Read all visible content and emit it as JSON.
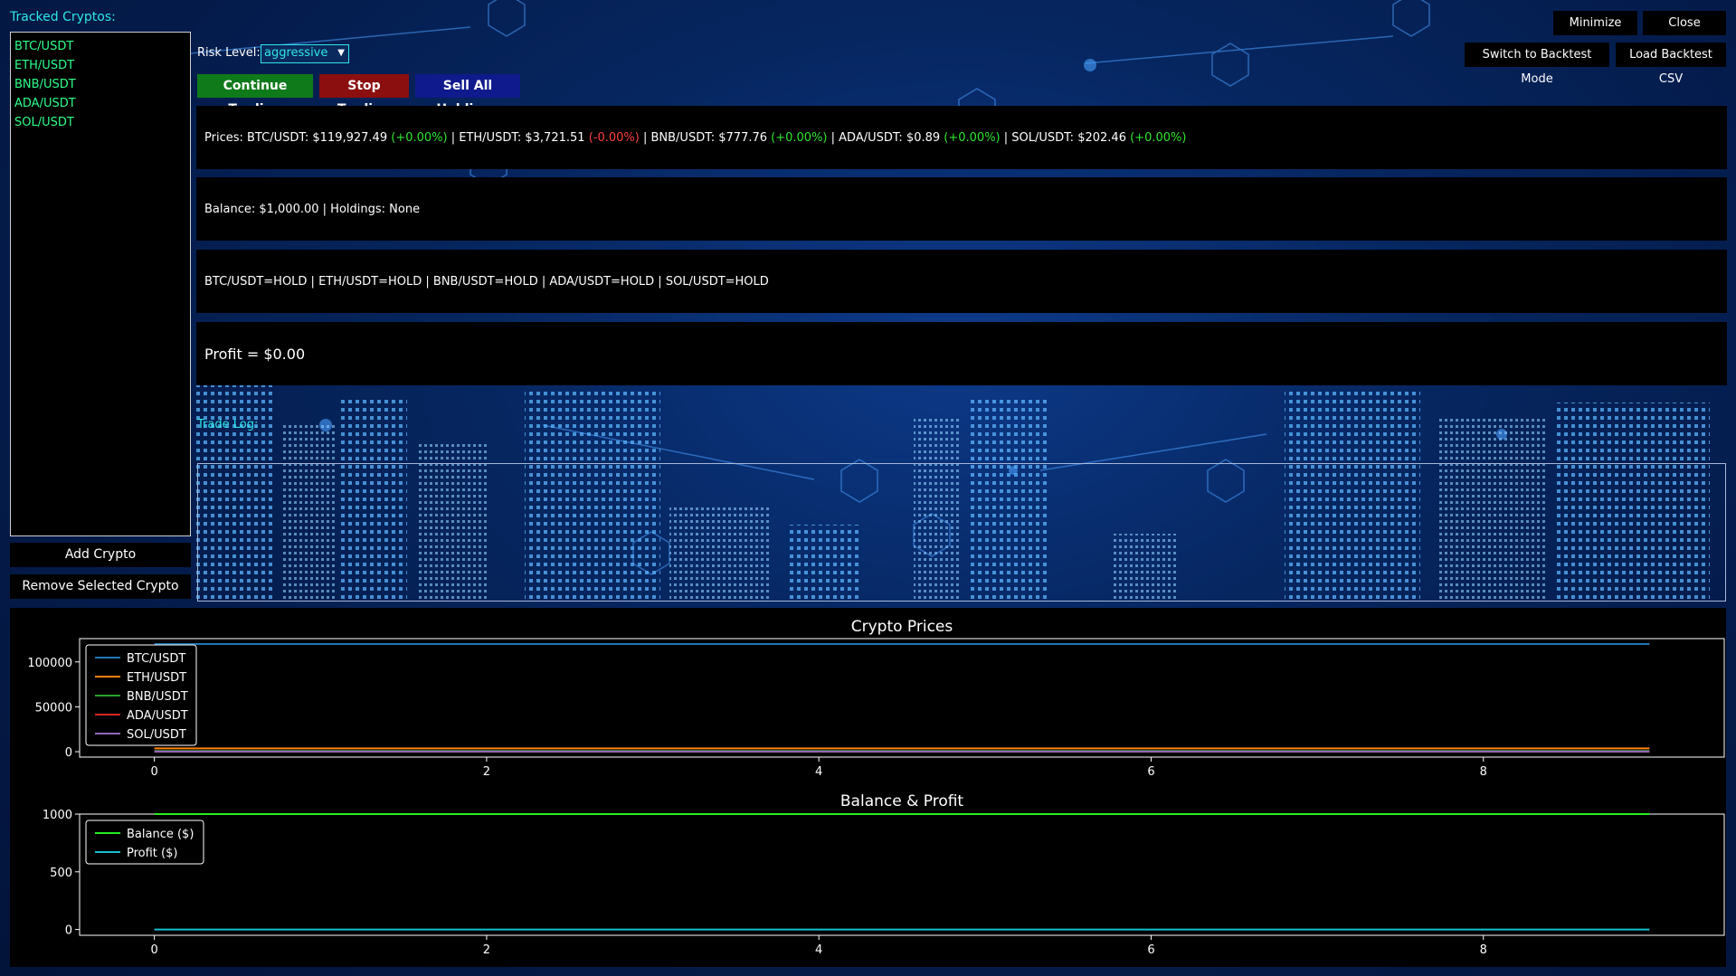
{
  "sidebar": {
    "title": "Tracked Cryptos:",
    "items": [
      "BTC/USDT",
      "ETH/USDT",
      "BNB/USDT",
      "ADA/USDT",
      "SOL/USDT"
    ],
    "add_button": "Add Crypto",
    "remove_button": "Remove Selected Crypto"
  },
  "controls": {
    "risk_label": "Risk Level:",
    "risk_value": "aggressive",
    "continue_button": "Continue Trading",
    "stop_button": "Stop Trading",
    "sell_all_button": "Sell All Holdings"
  },
  "window_buttons": {
    "minimize": "Minimize",
    "close": "Close",
    "switch_backtest": "Switch to Backtest Mode",
    "load_csv": "Load Backtest CSV"
  },
  "prices": {
    "prefix": "Prices:",
    "entries": [
      {
        "pair": "BTC/USDT:",
        "price": "$119,927.49",
        "change": "(+0.00%)",
        "dir": "up"
      },
      {
        "pair": "ETH/USDT:",
        "price": "$3,721.51",
        "change": "(-0.00%)",
        "dir": "down"
      },
      {
        "pair": "BNB/USDT:",
        "price": "$777.76",
        "change": "(+0.00%)",
        "dir": "up"
      },
      {
        "pair": "ADA/USDT:",
        "price": "$0.89",
        "change": "(+0.00%)",
        "dir": "up"
      },
      {
        "pair": "SOL/USDT:",
        "price": "$202.46",
        "change": "(+0.00%)",
        "dir": "up"
      }
    ]
  },
  "balance_text": "Balance: $1,000.00 | Holdings: None",
  "signals_text": "BTC/USDT=HOLD | ETH/USDT=HOLD | BNB/USDT=HOLD | ADA/USDT=HOLD | SOL/USDT=HOLD",
  "profit_text": "Profit = $0.00",
  "trade_log_label": "Trade Log:",
  "colors": {
    "continue": "#0f7a1a",
    "stop": "#8c0f0f",
    "sell": "#0f1a8c",
    "accent": "#2ee6e6"
  },
  "chart_data": [
    {
      "type": "line",
      "title": "Crypto Prices",
      "x": [
        0,
        1,
        2,
        3,
        4,
        5,
        6,
        7,
        8,
        9
      ],
      "xticks": [
        "0",
        "2",
        "4",
        "6",
        "8"
      ],
      "yticks": [
        "0",
        "50000",
        "100000"
      ],
      "xlim": [
        -0.45,
        9.45
      ],
      "ylim": [
        -6000,
        126000
      ],
      "legend_position": "upper-left",
      "series": [
        {
          "name": "BTC/USDT",
          "color": "#1f77b4",
          "values": [
            119927.49,
            119927.49,
            119927.49,
            119927.49,
            119927.49,
            119927.49,
            119927.49,
            119927.49,
            119927.49,
            119927.49
          ]
        },
        {
          "name": "ETH/USDT",
          "color": "#ff7f0e",
          "values": [
            3721.51,
            3721.51,
            3721.51,
            3721.51,
            3721.51,
            3721.51,
            3721.51,
            3721.51,
            3721.51,
            3721.51
          ]
        },
        {
          "name": "BNB/USDT",
          "color": "#2ca02c",
          "values": [
            777.76,
            777.76,
            777.76,
            777.76,
            777.76,
            777.76,
            777.76,
            777.76,
            777.76,
            777.76
          ]
        },
        {
          "name": "ADA/USDT",
          "color": "#d62728",
          "values": [
            0.89,
            0.89,
            0.89,
            0.89,
            0.89,
            0.89,
            0.89,
            0.89,
            0.89,
            0.89
          ]
        },
        {
          "name": "SOL/USDT",
          "color": "#9467bd",
          "values": [
            202.46,
            202.46,
            202.46,
            202.46,
            202.46,
            202.46,
            202.46,
            202.46,
            202.46,
            202.46
          ]
        }
      ]
    },
    {
      "type": "line",
      "title": "Balance & Profit",
      "x": [
        0,
        1,
        2,
        3,
        4,
        5,
        6,
        7,
        8,
        9
      ],
      "xticks": [
        "0",
        "2",
        "4",
        "6",
        "8"
      ],
      "yticks": [
        "0",
        "500",
        "1000"
      ],
      "xlim": [
        -0.45,
        9.45
      ],
      "ylim": [
        -50,
        1000
      ],
      "legend_position": "upper-left",
      "series": [
        {
          "name": "Balance ($)",
          "color": "#22ee22",
          "values": [
            1000,
            1000,
            1000,
            1000,
            1000,
            1000,
            1000,
            1000,
            1000,
            1000
          ]
        },
        {
          "name": "Profit ($)",
          "color": "#17becf",
          "values": [
            0,
            0,
            0,
            0,
            0,
            0,
            0,
            0,
            0,
            0
          ]
        }
      ]
    }
  ]
}
